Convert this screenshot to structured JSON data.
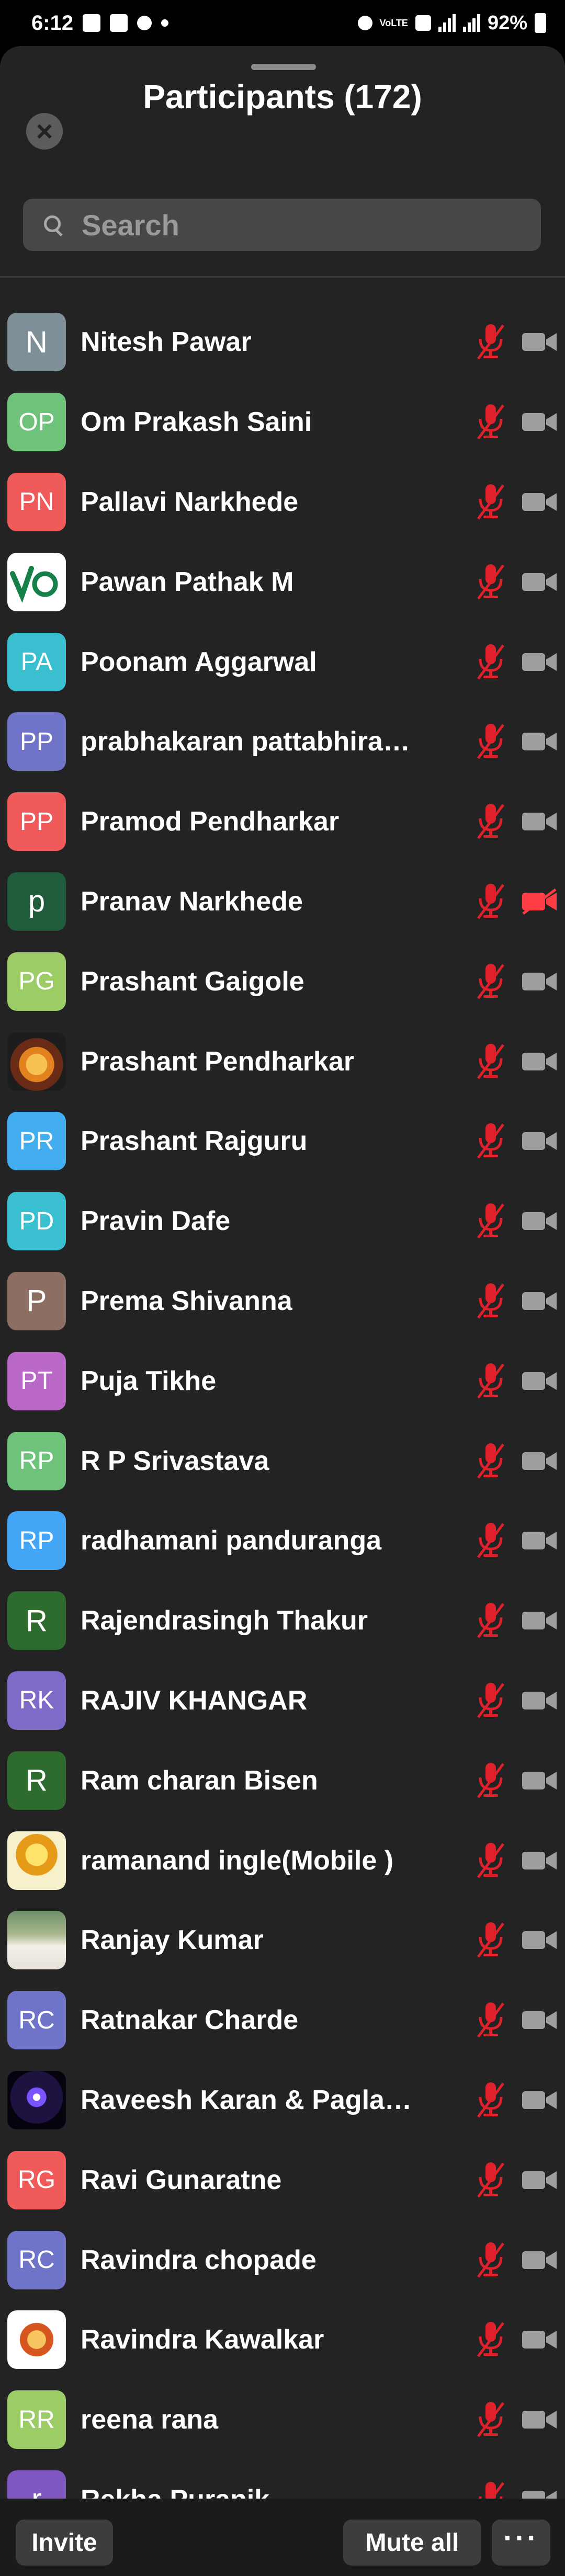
{
  "status_bar": {
    "time": "6:12",
    "battery": "92%",
    "network_label": "VoLTE"
  },
  "header": {
    "title": "Participants (172)"
  },
  "search": {
    "placeholder": "Search"
  },
  "colors": {
    "mic_muted": "#e0202a",
    "cam_off": "#ff3b44",
    "cam_icon": "#9e9e9e"
  },
  "participants": [
    {
      "initials": "N",
      "name": "Nitesh Pawar",
      "color": "#7f8f98",
      "camera": "on"
    },
    {
      "initials": "OP",
      "name": "Om Prakash Saini",
      "color": "#6ec27a",
      "camera": "on"
    },
    {
      "initials": "PN",
      "name": "Pallavi Narkhede",
      "color": "#f05a5a",
      "camera": "on"
    },
    {
      "initials": "",
      "name": "Pawan Pathak M",
      "color": "#ffffff",
      "picture": "vo",
      "camera": "on"
    },
    {
      "initials": "PA",
      "name": "Poonam Aggarwal",
      "color": "#39bfd0",
      "camera": "on"
    },
    {
      "initials": "PP",
      "name": "prabhakaran pattabhira…",
      "color": "#6f74c8",
      "camera": "on"
    },
    {
      "initials": "PP",
      "name": "Pramod Pendharkar",
      "color": "#f05a5a",
      "camera": "on"
    },
    {
      "initials": "p",
      "name": "Pranav Narkhede",
      "color": "#1e5c3c",
      "camera": "off"
    },
    {
      "initials": "PG",
      "name": "Prashant Gaigole",
      "color": "#9ccc65",
      "camera": "on"
    },
    {
      "initials": "",
      "name": "Prashant Pendharkar",
      "color": "#1d1d1d",
      "picture": "swami",
      "camera": "on"
    },
    {
      "initials": "PR",
      "name": "Prashant Rajguru",
      "color": "#42aef0",
      "camera": "on"
    },
    {
      "initials": "PD",
      "name": "Pravin Dafe",
      "color": "#39bfd0",
      "camera": "on"
    },
    {
      "initials": "P",
      "name": "Prema Shivanna",
      "color": "#8d6e63",
      "camera": "on"
    },
    {
      "initials": "PT",
      "name": "Puja Tikhe",
      "color": "#ba68c8",
      "camera": "on"
    },
    {
      "initials": "RP",
      "name": "R P Srivastava",
      "color": "#6ec27a",
      "camera": "on"
    },
    {
      "initials": "RP",
      "name": "radhamani panduranga",
      "color": "#42a5f5",
      "camera": "on"
    },
    {
      "initials": "R",
      "name": "Rajendrasingh Thakur",
      "color": "#2e6b2e",
      "camera": "on"
    },
    {
      "initials": "RK",
      "name": "RAJIV KHANGAR",
      "color": "#7e6bc8",
      "camera": "on"
    },
    {
      "initials": "R",
      "name": "Ram charan Bisen",
      "color": "#2e6b2e",
      "camera": "on"
    },
    {
      "initials": "",
      "name": "ramanand ingle(Mobile )",
      "color": "#f0a020",
      "picture": "logo",
      "camera": "on"
    },
    {
      "initials": "",
      "name": "Ranjay Kumar",
      "color": "#6d8f6a",
      "picture": "man",
      "camera": "on"
    },
    {
      "initials": "RC",
      "name": "Ratnakar Charde",
      "color": "#6f74c8",
      "camera": "on"
    },
    {
      "initials": "",
      "name": "Raveesh Karan & Pagla…",
      "color": "#05030e",
      "picture": "spark",
      "camera": "on"
    },
    {
      "initials": "RG",
      "name": "Ravi Gunaratne",
      "color": "#f05a5a",
      "camera": "on"
    },
    {
      "initials": "RC",
      "name": "Ravindra chopade",
      "color": "#6f74c8",
      "camera": "on"
    },
    {
      "initials": "",
      "name": "Ravindra Kawalkar",
      "color": "#ffffff",
      "picture": "swami2",
      "camera": "on"
    },
    {
      "initials": "RR",
      "name": "reena rana",
      "color": "#9ccc65",
      "camera": "on"
    },
    {
      "initials": "r",
      "name": "Rekha Puranik",
      "color": "#7e57c2",
      "camera": "on"
    }
  ],
  "footer": {
    "invite_label": "Invite",
    "mute_all_label": "Mute all",
    "more_label": "···"
  }
}
